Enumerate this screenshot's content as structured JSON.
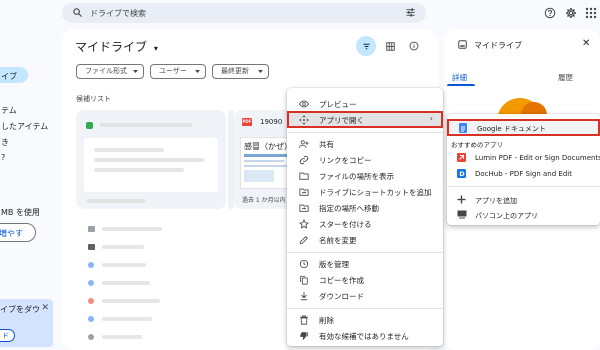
{
  "search": {
    "placeholder": "ドライブで検索"
  },
  "nav": {
    "active_label": "イブ",
    "items": [
      "テム",
      "したアイテム",
      "き",
      "?"
    ],
    "storage_text": "MB を使用",
    "storage_button": "増やす",
    "promo_text": "イブをダウ",
    "promo_button": "ド",
    "promo_close": "✕"
  },
  "main": {
    "title": "マイドライブ",
    "filters": [
      "ファイル形式",
      "ユーザー",
      "最終更新"
    ],
    "suggested_label": "候補リスト",
    "doc_card": {
      "file_name": "19090",
      "badge": "PDF",
      "thumb_heading": "感冒（かぜ）",
      "caption": "過去 1 か月以内"
    }
  },
  "context_menu": {
    "items": [
      {
        "label": "プレビュー",
        "icon": "eye-icon"
      },
      {
        "label": "アプリで開く",
        "icon": "apps-move-icon",
        "submenu": true
      },
      {
        "label": "共有",
        "icon": "person-add-icon"
      },
      {
        "label": "リンクをコピー",
        "icon": "link-icon"
      },
      {
        "label": "ファイルの場所を表示",
        "icon": "folder-icon"
      },
      {
        "label": "ドライブにショートカットを追加",
        "icon": "shortcut-icon"
      },
      {
        "label": "指定の場所へ移動",
        "icon": "move-icon"
      },
      {
        "label": "スターを付ける",
        "icon": "star-icon"
      },
      {
        "label": "名前を変更",
        "icon": "pencil-icon"
      },
      {
        "label": "版を管理",
        "icon": "history-icon"
      },
      {
        "label": "コピーを作成",
        "icon": "copy-icon"
      },
      {
        "label": "ダウンロード",
        "icon": "download-icon"
      },
      {
        "label": "削除",
        "icon": "trash-icon"
      },
      {
        "label": "有効な候補ではありません",
        "icon": "thumb-down-icon"
      }
    ],
    "submenu_arrow": "›"
  },
  "submenu": {
    "google_docs": "Google ドキュメント",
    "suggested_header": "おすすめのアプリ",
    "lumin": "Lumin PDF - Edit or Sign Documents",
    "dochub": "DocHub - PDF Sign and Edit",
    "add_app": "アプリを追加",
    "pc_app": "パソコン上のアプリ"
  },
  "details": {
    "title": "マイドライブ",
    "tabs": [
      "詳細",
      "履歴"
    ],
    "close": "✕"
  },
  "colors": {
    "accent": "#0b57d0",
    "highlight_box": "#d93025",
    "nav_active": "#c2e7ff"
  }
}
